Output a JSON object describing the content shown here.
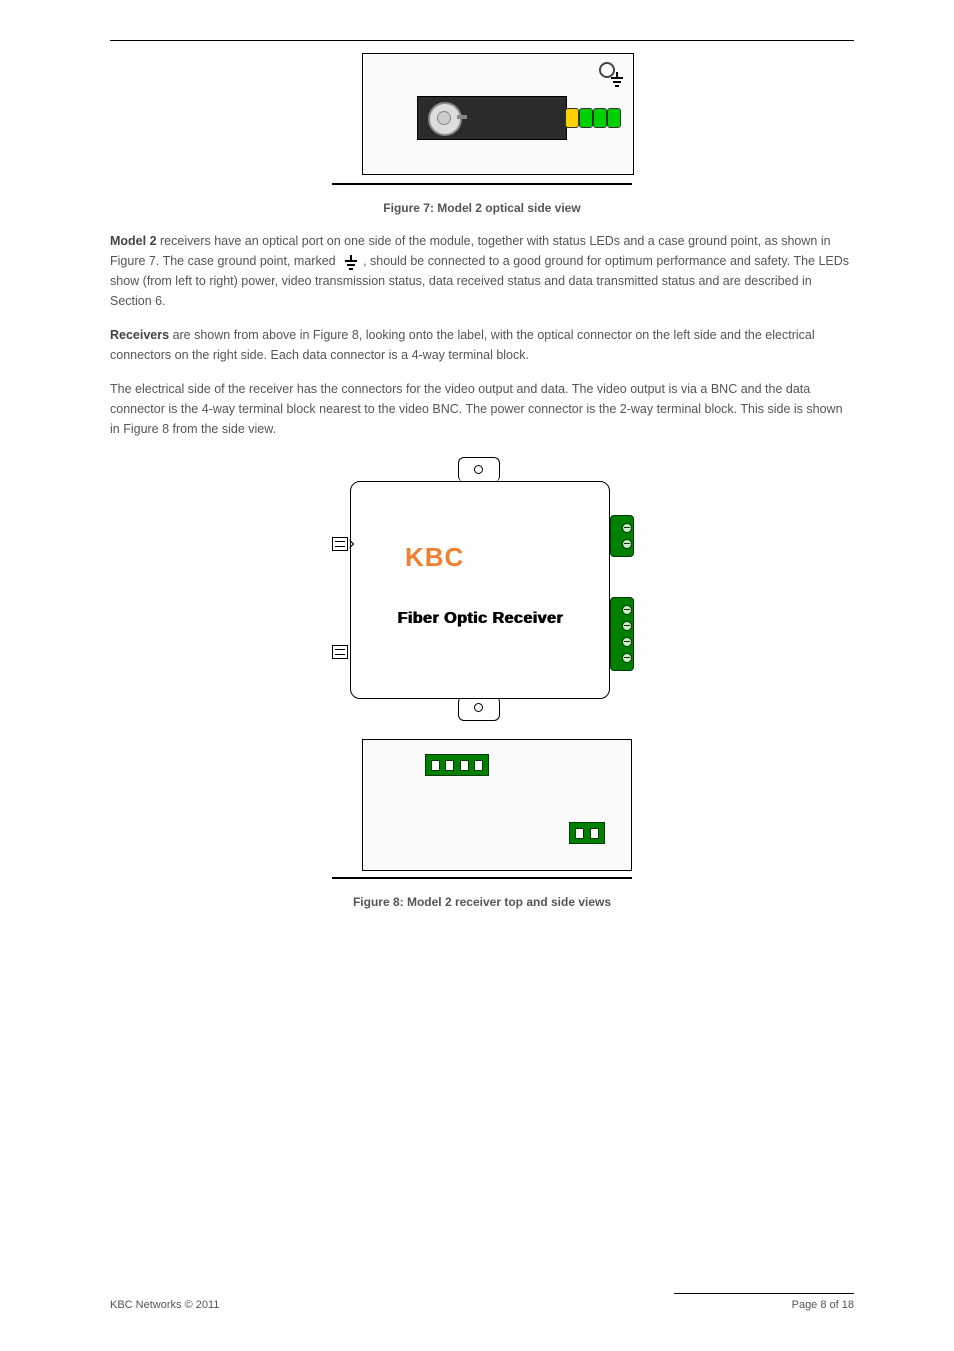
{
  "fig7": {
    "caption": "Figure 7: Model 2 optical side view"
  },
  "paragraph1_lead": "Model 2 ",
  "paragraph1_rest_a": "receivers have an optical port on one side of the module, together with status LEDs and a case ground point, as shown in Figure 7. The case ground point, marked",
  "paragraph1_rest_b": ", should be connected to a good ground for optimum performance and safety. The LEDs show (from left to right) power, video transmission status, data received status and data transmitted status and are described in Section 6.",
  "paragraph2_lead": "Receivers ",
  "paragraph2_rest": "are shown from above in Figure 8, looking onto the label, with the optical connector on the left side and the electrical connectors on the right side. Each data connector is a 4-way terminal block.",
  "paragraph3": "The electrical side of the receiver has the connectors for the video output and data. The video output is via a BNC and the data connector is the 4-way terminal block nearest to the video BNC. The power connector is the 2-way terminal block. This side is shown in Figure 8 from the side view.",
  "fig8": {
    "logo": "KBC",
    "label": "Fiber Optic Receiver",
    "caption": "Figure 8: Model 2 receiver top and side views"
  },
  "footer": {
    "left": "KBC Networks © 2011",
    "right": "Page 8 of 18"
  }
}
